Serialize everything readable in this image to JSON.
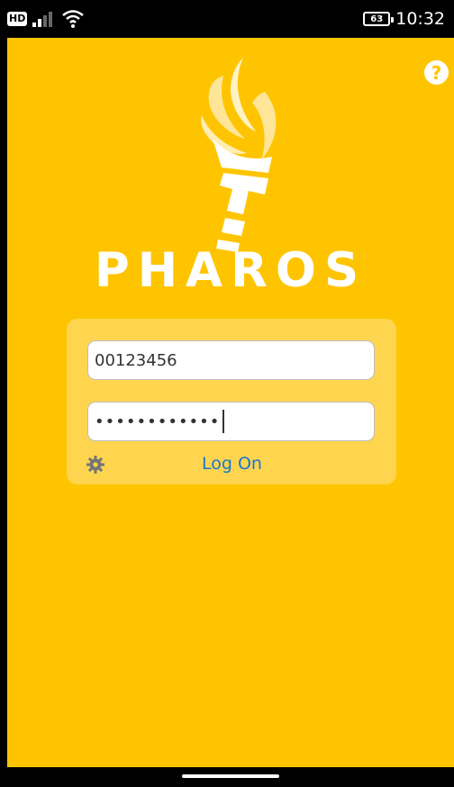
{
  "status_bar": {
    "hd_label": "HD",
    "battery_level": "63",
    "time": "10:32",
    "icons": [
      "signal-icon",
      "wifi-icon",
      "battery-icon"
    ]
  },
  "app": {
    "brand_name": "PHAROS",
    "help_symbol": "?",
    "username_value": "00123456",
    "password_mask": "••••••••••••",
    "logon_label": "Log On",
    "colors": {
      "background": "#FFC400",
      "card": "#FFD54F",
      "link": "#1976D2"
    }
  }
}
